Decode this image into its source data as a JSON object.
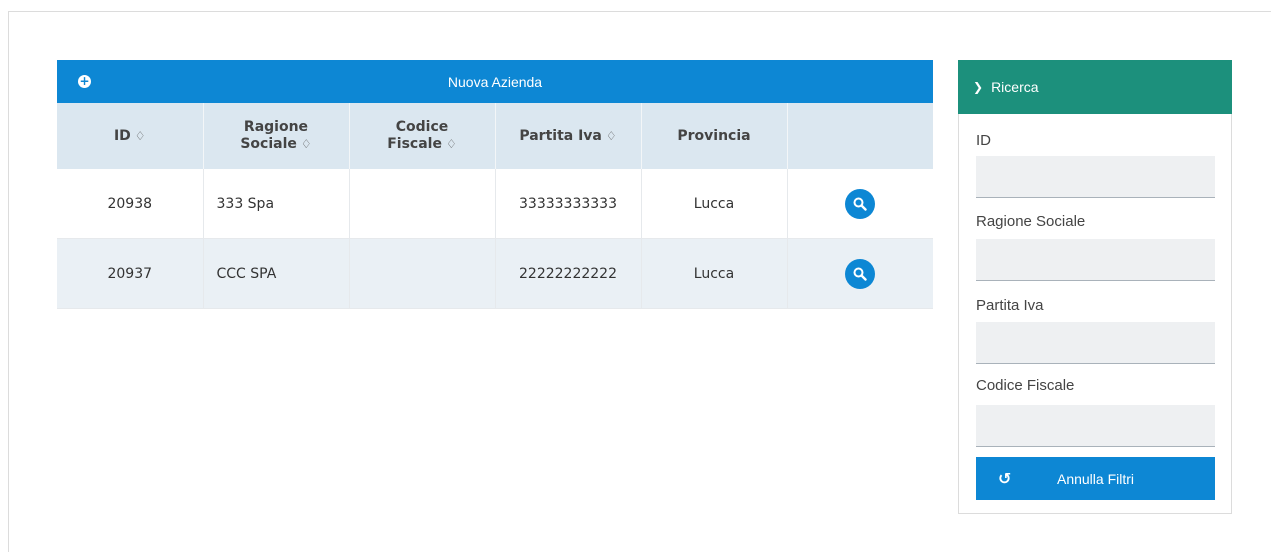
{
  "grid": {
    "new_button_label": "Nuova Azienda",
    "columns": [
      {
        "label": "ID",
        "sortable": true
      },
      {
        "label": "Ragione Sociale",
        "sortable": true
      },
      {
        "label": "Codice Fiscale",
        "sortable": true
      },
      {
        "label": "Partita Iva",
        "sortable": true
      },
      {
        "label": "Provincia",
        "sortable": false
      },
      {
        "label": "",
        "sortable": false
      }
    ],
    "rows": [
      {
        "id": "20938",
        "ragione_sociale": "333 Spa",
        "codice_fiscale": "",
        "partita_iva": "33333333333",
        "provincia": "Lucca"
      },
      {
        "id": "20937",
        "ragione_sociale": "CCC SPA",
        "codice_fiscale": "",
        "partita_iva": "22222222222",
        "provincia": "Lucca"
      }
    ],
    "sort_icon": "♢",
    "icons": {
      "new": "plus-circle-icon",
      "view": "search-icon"
    }
  },
  "search": {
    "title": "Ricerca",
    "chevron_icon": "chevron-down-icon",
    "fields": [
      {
        "label": "ID",
        "value": ""
      },
      {
        "label": "Ragione Sociale",
        "value": ""
      },
      {
        "label": "Partita Iva",
        "value": ""
      },
      {
        "label": "Codice Fiscale",
        "value": ""
      }
    ],
    "reset_label": "Annulla Filtri",
    "reset_icon": "undo-icon"
  },
  "colors": {
    "primary": "#0d87d4",
    "panel_header": "#1c907c",
    "table_header": "#dbe7f0",
    "alt_row": "#eaf0f5"
  }
}
